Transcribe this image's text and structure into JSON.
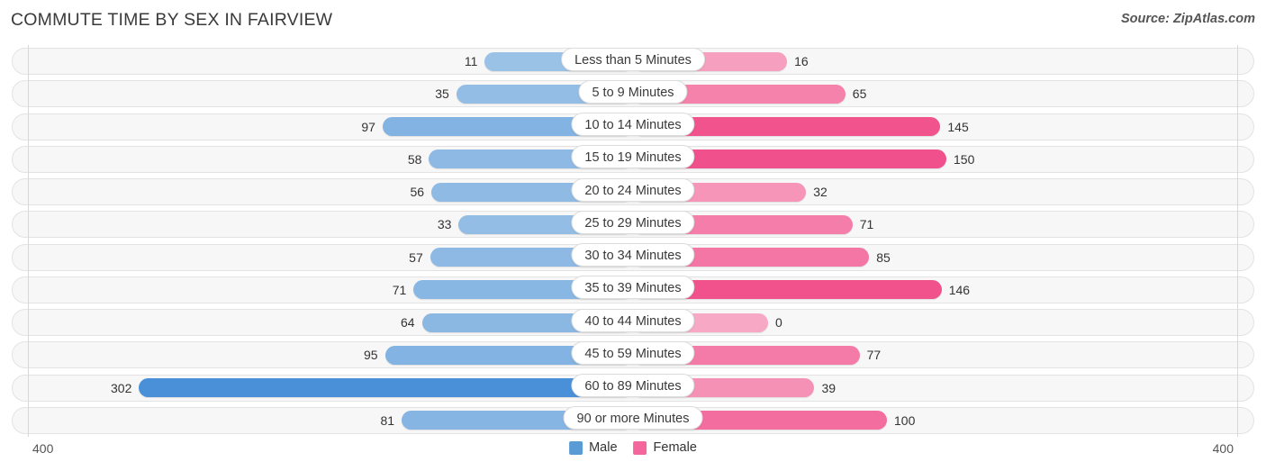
{
  "header": {
    "title": "COMMUTE TIME BY SEX IN FAIRVIEW",
    "source": "Source: ZipAtlas.com"
  },
  "axis": {
    "left_label": "400",
    "right_label": "400",
    "max": 400
  },
  "legend": {
    "male": {
      "label": "Male",
      "color": "#5b9bd5"
    },
    "female": {
      "label": "Female",
      "color": "#f4679d"
    }
  },
  "chart_data": {
    "type": "bar",
    "title": "COMMUTE TIME BY SEX IN FAIRVIEW",
    "orientation": "horizontal-diverging",
    "xlabel": "",
    "ylabel": "",
    "xlim": [
      400,
      400
    ],
    "grid": false,
    "legend_position": "bottom-center",
    "categories": [
      "Less than 5 Minutes",
      "5 to 9 Minutes",
      "10 to 14 Minutes",
      "15 to 19 Minutes",
      "20 to 24 Minutes",
      "25 to 29 Minutes",
      "30 to 34 Minutes",
      "35 to 39 Minutes",
      "40 to 44 Minutes",
      "45 to 59 Minutes",
      "60 to 89 Minutes",
      "90 or more Minutes"
    ],
    "series": [
      {
        "name": "Male",
        "color": "#9dc3e6",
        "values": [
          11,
          35,
          97,
          58,
          56,
          33,
          57,
          71,
          64,
          95,
          302,
          81
        ]
      },
      {
        "name": "Female",
        "color": "#f7a8c4",
        "values": [
          16,
          65,
          145,
          150,
          32,
          71,
          85,
          146,
          0,
          77,
          39,
          100
        ]
      }
    ]
  },
  "rows": [
    {
      "category": "Less than 5 Minutes",
      "male": "11",
      "female": "16",
      "male_value": 11,
      "female_value": 16
    },
    {
      "category": "5 to 9 Minutes",
      "male": "35",
      "female": "65",
      "male_value": 35,
      "female_value": 65
    },
    {
      "category": "10 to 14 Minutes",
      "male": "97",
      "female": "145",
      "male_value": 97,
      "female_value": 145
    },
    {
      "category": "15 to 19 Minutes",
      "male": "58",
      "female": "150",
      "male_value": 58,
      "female_value": 150
    },
    {
      "category": "20 to 24 Minutes",
      "male": "56",
      "female": "32",
      "male_value": 56,
      "female_value": 32
    },
    {
      "category": "25 to 29 Minutes",
      "male": "33",
      "female": "71",
      "male_value": 33,
      "female_value": 71
    },
    {
      "category": "30 to 34 Minutes",
      "male": "57",
      "female": "85",
      "male_value": 57,
      "female_value": 85
    },
    {
      "category": "35 to 39 Minutes",
      "male": "71",
      "female": "146",
      "male_value": 71,
      "female_value": 146
    },
    {
      "category": "40 to 44 Minutes",
      "male": "64",
      "female": "0",
      "male_value": 64,
      "female_value": 0
    },
    {
      "category": "45 to 59 Minutes",
      "male": "95",
      "female": "77",
      "male_value": 95,
      "female_value": 77
    },
    {
      "category": "60 to 89 Minutes",
      "male": "302",
      "female": "39",
      "male_value": 302,
      "female_value": 39
    },
    {
      "category": "90 or more Minutes",
      "male": "81",
      "female": "100",
      "male_value": 81,
      "female_value": 100
    }
  ]
}
